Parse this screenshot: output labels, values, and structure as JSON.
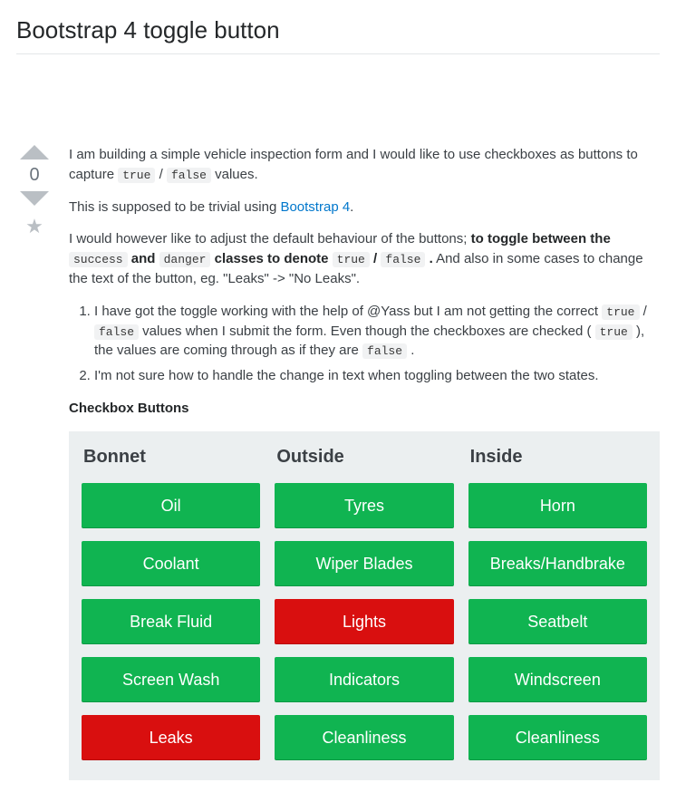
{
  "title": "Bootstrap 4 toggle button",
  "votes": {
    "score": "0"
  },
  "body": {
    "p1_a": "I am building a simple vehicle inspection form and I would like to use checkboxes as buttons to capture ",
    "code_true": "true",
    "slash": " / ",
    "code_false": "false",
    "p1_b": " values.",
    "p2_a": "This is supposed to be trivial using ",
    "link_text": "Bootstrap 4",
    "p2_b": ".",
    "p3_a": "I would however like to adjust the default behaviour of the buttons; ",
    "bold_a": "to toggle between the ",
    "code_success": "success",
    "bold_b": " and ",
    "code_danger": "danger",
    "bold_c": " classes to denote ",
    "bold_d": " .",
    "p3_b": " And also in some cases to change the text of the button, eg. \"Leaks\" -> \"No Leaks\".",
    "li1_a": "I have got the toggle working with the help of @Yass but I am not getting the correct ",
    "li1_b": " values when I submit the form. Even though the checkboxes are checked ( ",
    "li1_c": " ), the values are coming through as if they are ",
    "li1_d": " .",
    "li2": "I'm not sure how to handle the change in text when toggling between the two states.",
    "subheading": "Checkbox Buttons"
  },
  "panel": {
    "columns": [
      {
        "title": "Bonnet",
        "buttons": [
          {
            "label": "Oil",
            "state": "success"
          },
          {
            "label": "Coolant",
            "state": "success"
          },
          {
            "label": "Break Fluid",
            "state": "success"
          },
          {
            "label": "Screen Wash",
            "state": "success"
          },
          {
            "label": "Leaks",
            "state": "danger"
          }
        ]
      },
      {
        "title": "Outside",
        "buttons": [
          {
            "label": "Tyres",
            "state": "success"
          },
          {
            "label": "Wiper Blades",
            "state": "success"
          },
          {
            "label": "Lights",
            "state": "danger"
          },
          {
            "label": "Indicators",
            "state": "success"
          },
          {
            "label": "Cleanliness",
            "state": "success"
          }
        ]
      },
      {
        "title": "Inside",
        "buttons": [
          {
            "label": "Horn",
            "state": "success"
          },
          {
            "label": "Breaks/Handbrake",
            "state": "success"
          },
          {
            "label": "Seatbelt",
            "state": "success"
          },
          {
            "label": "Windscreen",
            "state": "success"
          },
          {
            "label": "Cleanliness",
            "state": "success"
          }
        ]
      }
    ]
  }
}
